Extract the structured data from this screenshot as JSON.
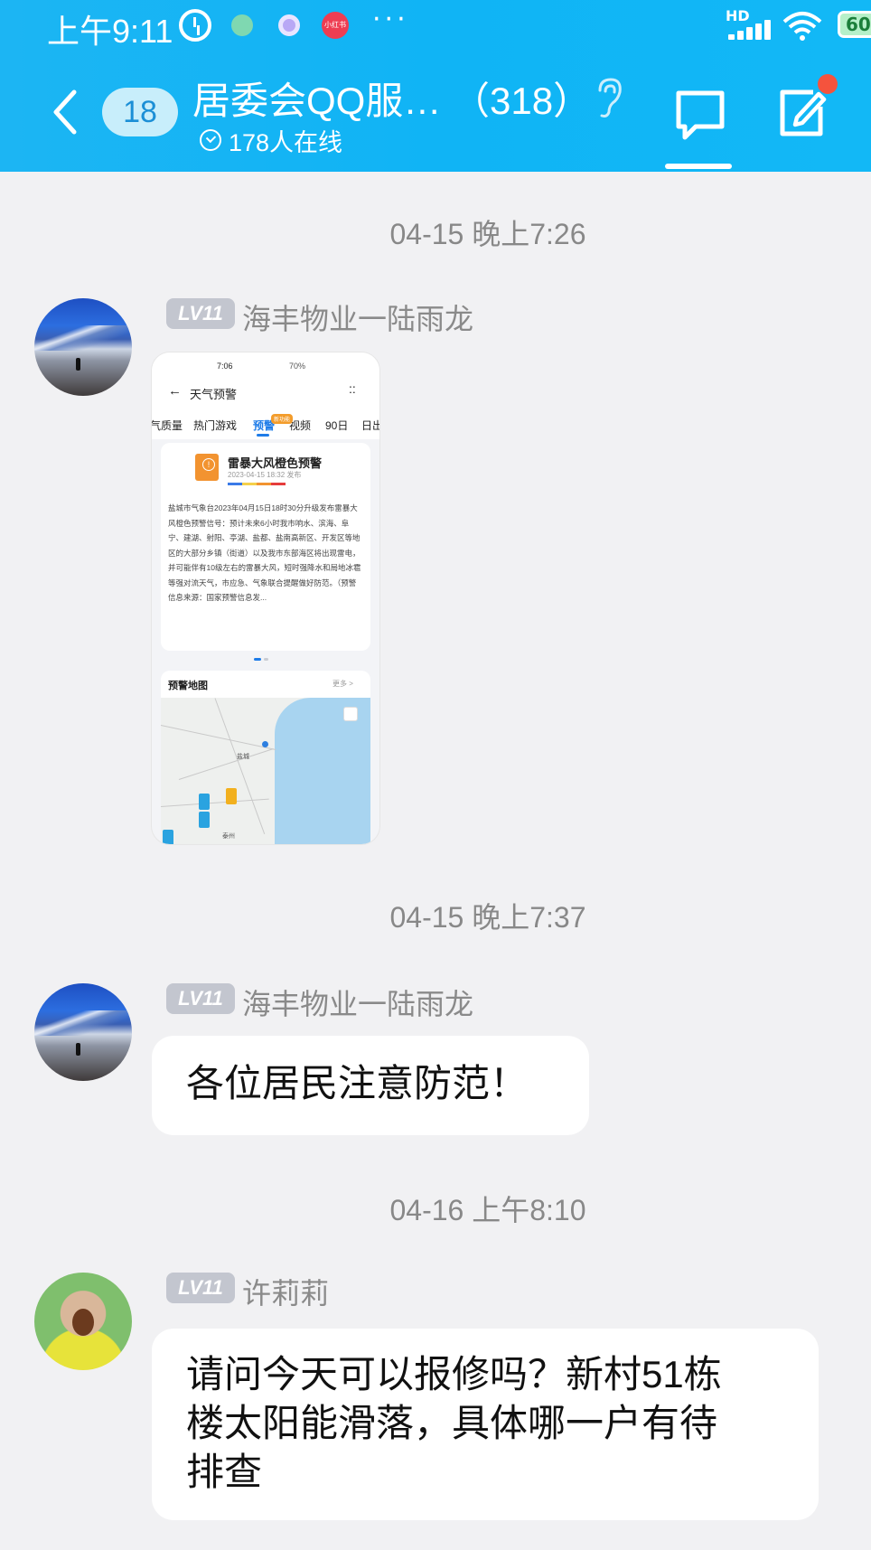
{
  "status_bar": {
    "time": "上午9:11",
    "notif_label": "小红书",
    "overflow": "···",
    "network": "HD",
    "battery": "60"
  },
  "header": {
    "back_icon": "chevron-left-icon",
    "unread_count": "18",
    "title": "居委会QQ服… （318）",
    "online_text": "178人在线",
    "accent": "#12b5f5"
  },
  "messages": [
    {
      "timestamp": "04-15 晚上7:26",
      "level": "LV11",
      "sender": "海丰物业一陆雨龙",
      "type": "image"
    },
    {
      "timestamp": "04-15 晚上7:37",
      "level": "LV11",
      "sender": "海丰物业一陆雨龙",
      "type": "text",
      "text": "各位居民注意防范！"
    },
    {
      "timestamp": "04-16 上午8:10",
      "level": "LV11",
      "sender": "许莉莉",
      "type": "text",
      "lines": [
        "请问今天可以报修吗？新村51栋",
        "楼太阳能滑落，具体哪一户有待",
        "排查"
      ]
    }
  ],
  "screenshot": {
    "time": "7:06",
    "status_right": "70%",
    "nav_title": "天气预警",
    "more": "::",
    "tabs": [
      "气质量",
      "热门游戏",
      "预警",
      "视频",
      "90日",
      "日出"
    ],
    "tab_badge": "新功能",
    "warning_title": "雷暴大风橙色预警",
    "warning_date": "2023-04-15 18:32 发布",
    "warning_body": "盐城市气象台2023年04月15日18时30分升级发布雷暴大风橙色预警信号：预计未来6小时我市响水、滨海、阜宁、建湖、射阳、亭湖、盐都、盐南高新区、开发区等地区的大部分乡镇（街道）以及我市东部海区将出现雷电，并可能伴有10级左右的雷暴大风，短时强降水和局地冰雹等强对流天气，市应急、气象联合提醒做好防范。（预警信息来源：国家预警信息发...",
    "map_title": "预警地图",
    "map_more": "更多 >",
    "cities": [
      "盐城",
      "泰州"
    ]
  }
}
